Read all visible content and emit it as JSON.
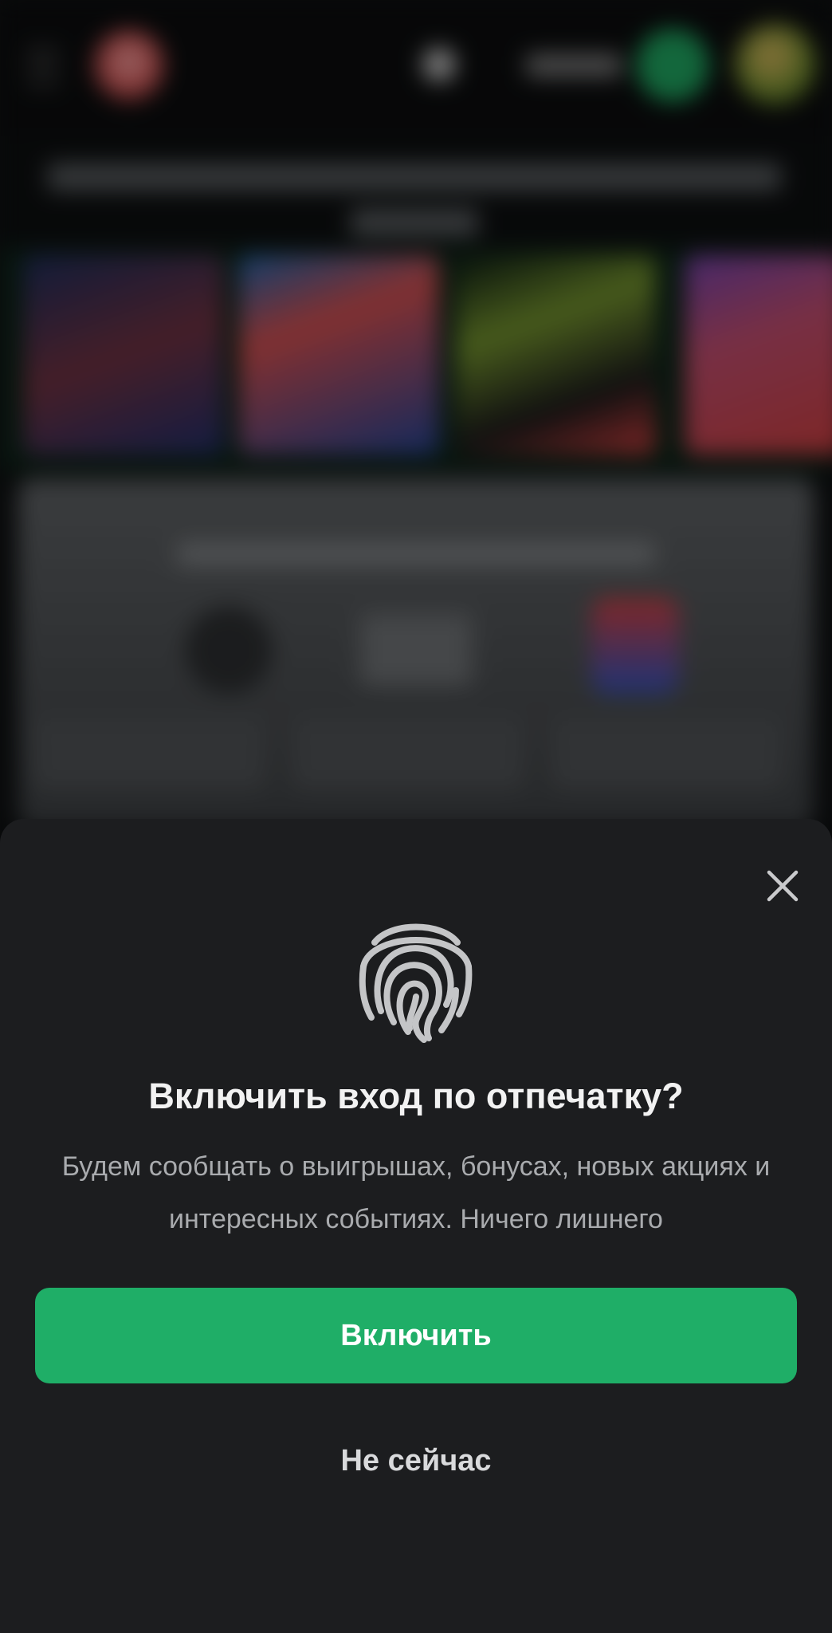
{
  "dialog": {
    "title": "Включить вход по отпечатку?",
    "description": "Будем сообщать о выигрышах, бонусах, новых акциях и интересных событиях. Ничего лишнего",
    "enable_label": "Включить",
    "later_label": "Не сейчас",
    "close_icon": "close-icon",
    "hero_icon": "fingerprint-icon"
  },
  "colors": {
    "sheet_background": "#1c1d1f",
    "accent_green": "#1fae67",
    "title_text": "#f2f2f2",
    "secondary_text": "#a9abae"
  }
}
